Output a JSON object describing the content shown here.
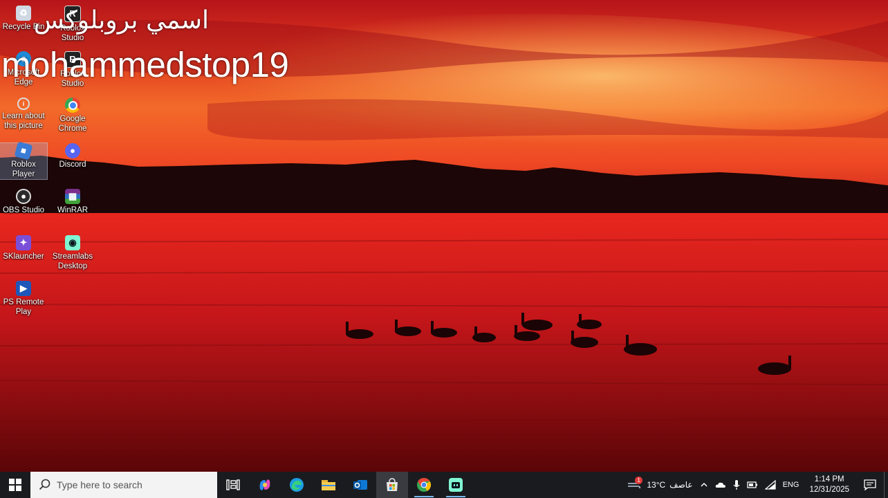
{
  "overlay": {
    "arabic_line": "اسمي بروبلوكس",
    "username_line": "mohammedstop19"
  },
  "desktop_icons": [
    {
      "label": "Recycle Bin",
      "icon": "recycle-bin-icon"
    },
    {
      "label": "Roblox Studio",
      "icon": "roblox-studio-icon"
    },
    {
      "label": "Microsoft Edge",
      "icon": "edge-icon"
    },
    {
      "label": "Roblox Studio",
      "icon": "roblox-studio-icon"
    },
    {
      "label": "Learn about this picture",
      "icon": "learn-about-picture-icon"
    },
    {
      "label": "Google Chrome",
      "icon": "chrome-icon"
    },
    {
      "label": "Roblox Player",
      "icon": "roblox-player-icon"
    },
    {
      "label": "Discord",
      "icon": "discord-icon"
    },
    {
      "label": "OBS Studio",
      "icon": "obs-icon"
    },
    {
      "label": "WinRAR",
      "icon": "winrar-icon"
    },
    {
      "label": "SKlauncher",
      "icon": "sklauncher-icon"
    },
    {
      "label": "Streamlabs Desktop",
      "icon": "streamlabs-icon"
    },
    {
      "label": "PS Remote Play",
      "icon": "ps-remote-play-icon"
    }
  ],
  "taskbar": {
    "search_placeholder": "Type here to search",
    "apps": [
      {
        "name": "Task View",
        "icon": "task-view-icon"
      },
      {
        "name": "Copilot",
        "icon": "copilot-icon"
      },
      {
        "name": "Microsoft Edge",
        "icon": "edge-icon"
      },
      {
        "name": "File Explorer",
        "icon": "file-explorer-icon"
      },
      {
        "name": "Outlook",
        "icon": "outlook-icon"
      },
      {
        "name": "Microsoft Store",
        "icon": "store-icon"
      },
      {
        "name": "Google Chrome",
        "icon": "chrome-icon"
      },
      {
        "name": "Streamlabs Desktop",
        "icon": "streamlabs-icon"
      }
    ],
    "weather": {
      "temperature": "13°C",
      "condition": "عاصف",
      "alert_count": "1"
    },
    "language": "ENG",
    "time": "1:14 PM",
    "date": "12/31/2025"
  },
  "colors": {
    "taskbar_bg": "#1a1b1f",
    "accent": "#76b9ed"
  }
}
